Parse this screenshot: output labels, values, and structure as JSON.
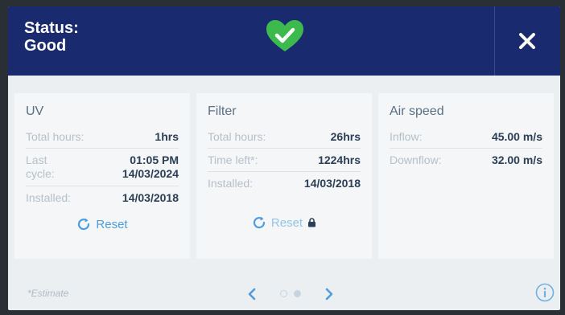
{
  "header": {
    "status_label": "Status:",
    "status_value": "Good",
    "status_icon": "heart-check-icon",
    "close_icon": "close-icon"
  },
  "cards": {
    "uv": {
      "title": "UV",
      "total_hours_label": "Total hours:",
      "total_hours_value": "1hrs",
      "last_cycle_label_1": "Last",
      "last_cycle_label_2": "cycle:",
      "last_cycle_time": "01:05 PM",
      "last_cycle_date": "14/03/2024",
      "installed_label": "Installed:",
      "installed_value": "14/03/2018",
      "reset_label": "Reset"
    },
    "filter": {
      "title": "Filter",
      "total_hours_label": "Total hours:",
      "total_hours_value": "26hrs",
      "time_left_label": "Time left*:",
      "time_left_value": "1224hrs",
      "installed_label": "Installed:",
      "installed_value": "14/03/2018",
      "reset_label": "Reset",
      "lock_icon": "lock-icon"
    },
    "air_speed": {
      "title": "Air speed",
      "inflow_label": "Inflow:",
      "inflow_value": "45.00 m/s",
      "downflow_label": "Downflow:",
      "downflow_value": "32.00 m/s"
    }
  },
  "footer": {
    "estimate_note": "*Estimate",
    "page_current": 2,
    "page_total": 2,
    "info_icon": "info-icon"
  },
  "colors": {
    "header_bg": "#1a2a6e",
    "accent_green": "#3dba4e",
    "link_blue": "#4d9dde",
    "value_text": "#2b3e57",
    "label_text": "#b6c0ca"
  }
}
